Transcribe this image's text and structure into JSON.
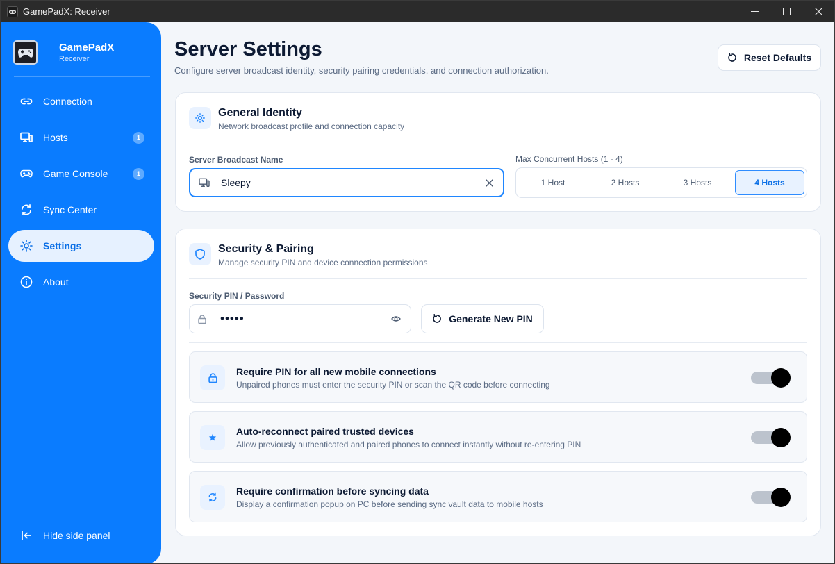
{
  "window": {
    "title": "GamePadX: Receiver"
  },
  "brand": {
    "name": "GamePadX",
    "subtitle": "Receiver"
  },
  "sidebar": {
    "items": [
      {
        "label": "Connection",
        "icon": "link-icon",
        "badge": null,
        "active": false
      },
      {
        "label": "Hosts",
        "icon": "monitor-icon",
        "badge": "1",
        "active": false
      },
      {
        "label": "Game Console",
        "icon": "gamepad-icon",
        "badge": "1",
        "active": false
      },
      {
        "label": "Sync Center",
        "icon": "sync-icon",
        "badge": null,
        "active": false
      },
      {
        "label": "Settings",
        "icon": "gear-icon",
        "badge": null,
        "active": true
      },
      {
        "label": "About",
        "icon": "info-icon",
        "badge": null,
        "active": false
      }
    ],
    "hide_label": "Hide side panel"
  },
  "header": {
    "title": "Server Settings",
    "description": "Configure server broadcast identity, security pairing credentials, and connection authorization.",
    "reset_label": "Reset Defaults"
  },
  "general": {
    "title": "General Identity",
    "subtitle": "Network broadcast profile and connection capacity",
    "name_label": "Server Broadcast Name",
    "name_value": "Sleepy",
    "hosts_label": "Max Concurrent Hosts (1 - 4)",
    "hosts_options": [
      "1 Host",
      "2 Hosts",
      "3 Hosts",
      "4 Hosts"
    ],
    "hosts_selected": "4 Hosts"
  },
  "security": {
    "title": "Security & Pairing",
    "subtitle": "Manage security PIN and device connection permissions",
    "pin_label": "Security PIN / Password",
    "pin_value": "•••••",
    "generate_label": "Generate New PIN",
    "toggles": [
      {
        "title": "Require PIN for all new mobile connections",
        "subtitle": "Unpaired phones must enter the security PIN or scan the QR code before connecting",
        "icon": "lock-icon",
        "on": true
      },
      {
        "title": "Auto-reconnect paired trusted devices",
        "subtitle": "Allow previously authenticated and paired phones to connect instantly without re-entering PIN",
        "icon": "star-icon",
        "on": true
      },
      {
        "title": "Require confirmation before syncing data",
        "subtitle": "Display a confirmation popup on PC before sending sync vault data to mobile hosts",
        "icon": "sync-icon",
        "on": true
      }
    ]
  },
  "colors": {
    "accent": "#0a7cff",
    "sidebar_active_bg": "#e6f1ff",
    "page_bg": "#f3f6fa"
  }
}
